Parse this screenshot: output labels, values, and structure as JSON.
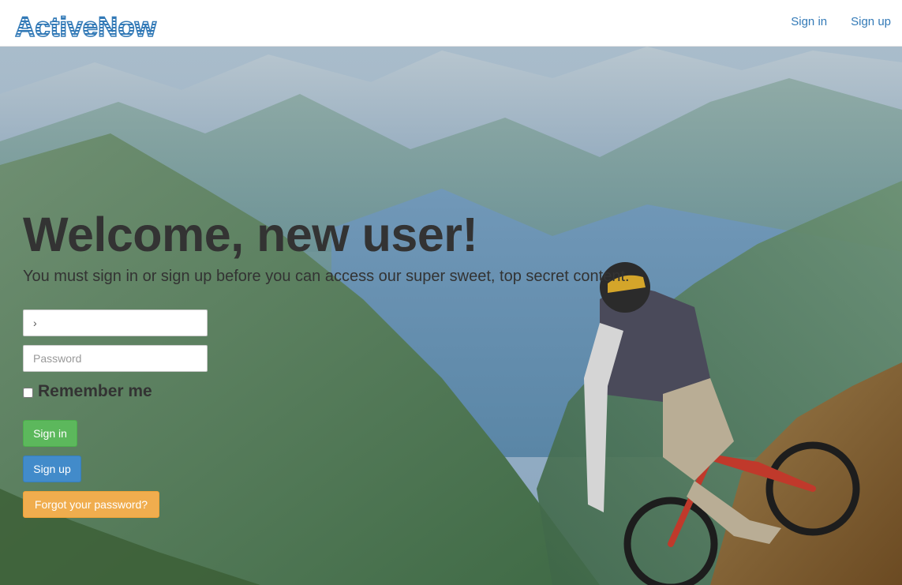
{
  "brand": {
    "name": "ActiveNow",
    "color": "#337ab7"
  },
  "nav": {
    "links": [
      {
        "label": "Sign in"
      },
      {
        "label": "Sign up"
      }
    ]
  },
  "hero": {
    "headline": "Welcome, new user!",
    "lead": "You must sign in or sign up before you can access our super sweet, top secret content.",
    "background": "mountain-biker-photo"
  },
  "form": {
    "email": {
      "value": "›",
      "placeholder": ""
    },
    "password": {
      "value": "",
      "placeholder": "Password"
    },
    "remember": {
      "label": "Remember me",
      "checked": false
    },
    "buttons": {
      "signin": "Sign in",
      "signup": "Sign up",
      "forgot": "Forgot your password?"
    }
  },
  "colors": {
    "success": "#5cb85c",
    "primary": "#428bca",
    "warning": "#f0ad4e",
    "link": "#337ab7",
    "text": "#333333"
  }
}
